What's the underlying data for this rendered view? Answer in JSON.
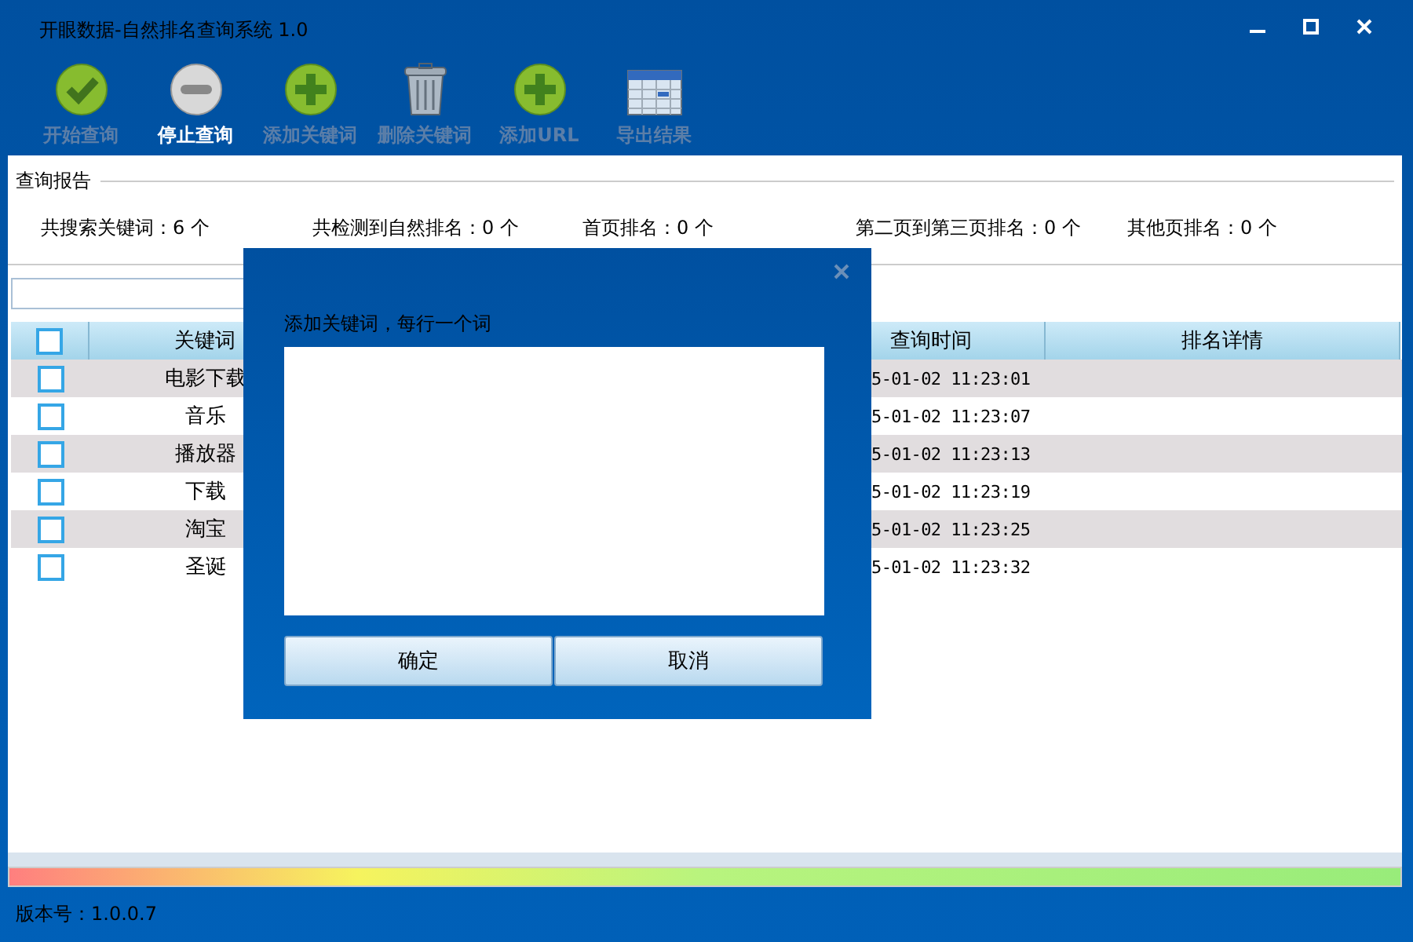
{
  "window": {
    "title": "开眼数据-自然排名查询系统 1.0"
  },
  "toolbar": [
    {
      "kind": "check",
      "label": "开始查询",
      "disabled": true
    },
    {
      "kind": "stop",
      "label": "停止查询",
      "disabled": false
    },
    {
      "kind": "add",
      "label": "添加关键词",
      "disabled": true
    },
    {
      "kind": "trash",
      "label": "删除关键词",
      "disabled": true
    },
    {
      "kind": "add",
      "label": "添加URL",
      "disabled": true
    },
    {
      "kind": "table",
      "label": "导出结果",
      "disabled": true
    }
  ],
  "report": {
    "title": "查询报告",
    "stats": [
      "共搜索关键词：6 个",
      "共检测到自然排名：0 个",
      "首页排名：0 个",
      "第二页到第三页排名：0 个",
      "其他页排名：0 个"
    ]
  },
  "table": {
    "select_all": {
      "checked": false
    },
    "columns": [
      "关键词",
      "查询时间",
      "排名详情"
    ],
    "rows": [
      {
        "checked": false,
        "keyword": "电影下载",
        "time": "5-01-02 11:23:01"
      },
      {
        "checked": false,
        "keyword": "音乐",
        "time": "5-01-02 11:23:07"
      },
      {
        "checked": false,
        "keyword": "播放器",
        "time": "5-01-02 11:23:13"
      },
      {
        "checked": false,
        "keyword": "下载",
        "time": "5-01-02 11:23:19"
      },
      {
        "checked": false,
        "keyword": "淘宝",
        "time": "5-01-02 11:23:25"
      },
      {
        "checked": false,
        "keyword": "圣诞",
        "time": "5-01-02 11:23:32"
      }
    ]
  },
  "progress": {
    "level": 1
  },
  "status_bar": {
    "version": "版本号：1.0.0.7"
  },
  "dialog": {
    "label": "添加关键词，每行一个词",
    "buttons": [
      "确定",
      "取消"
    ]
  }
}
